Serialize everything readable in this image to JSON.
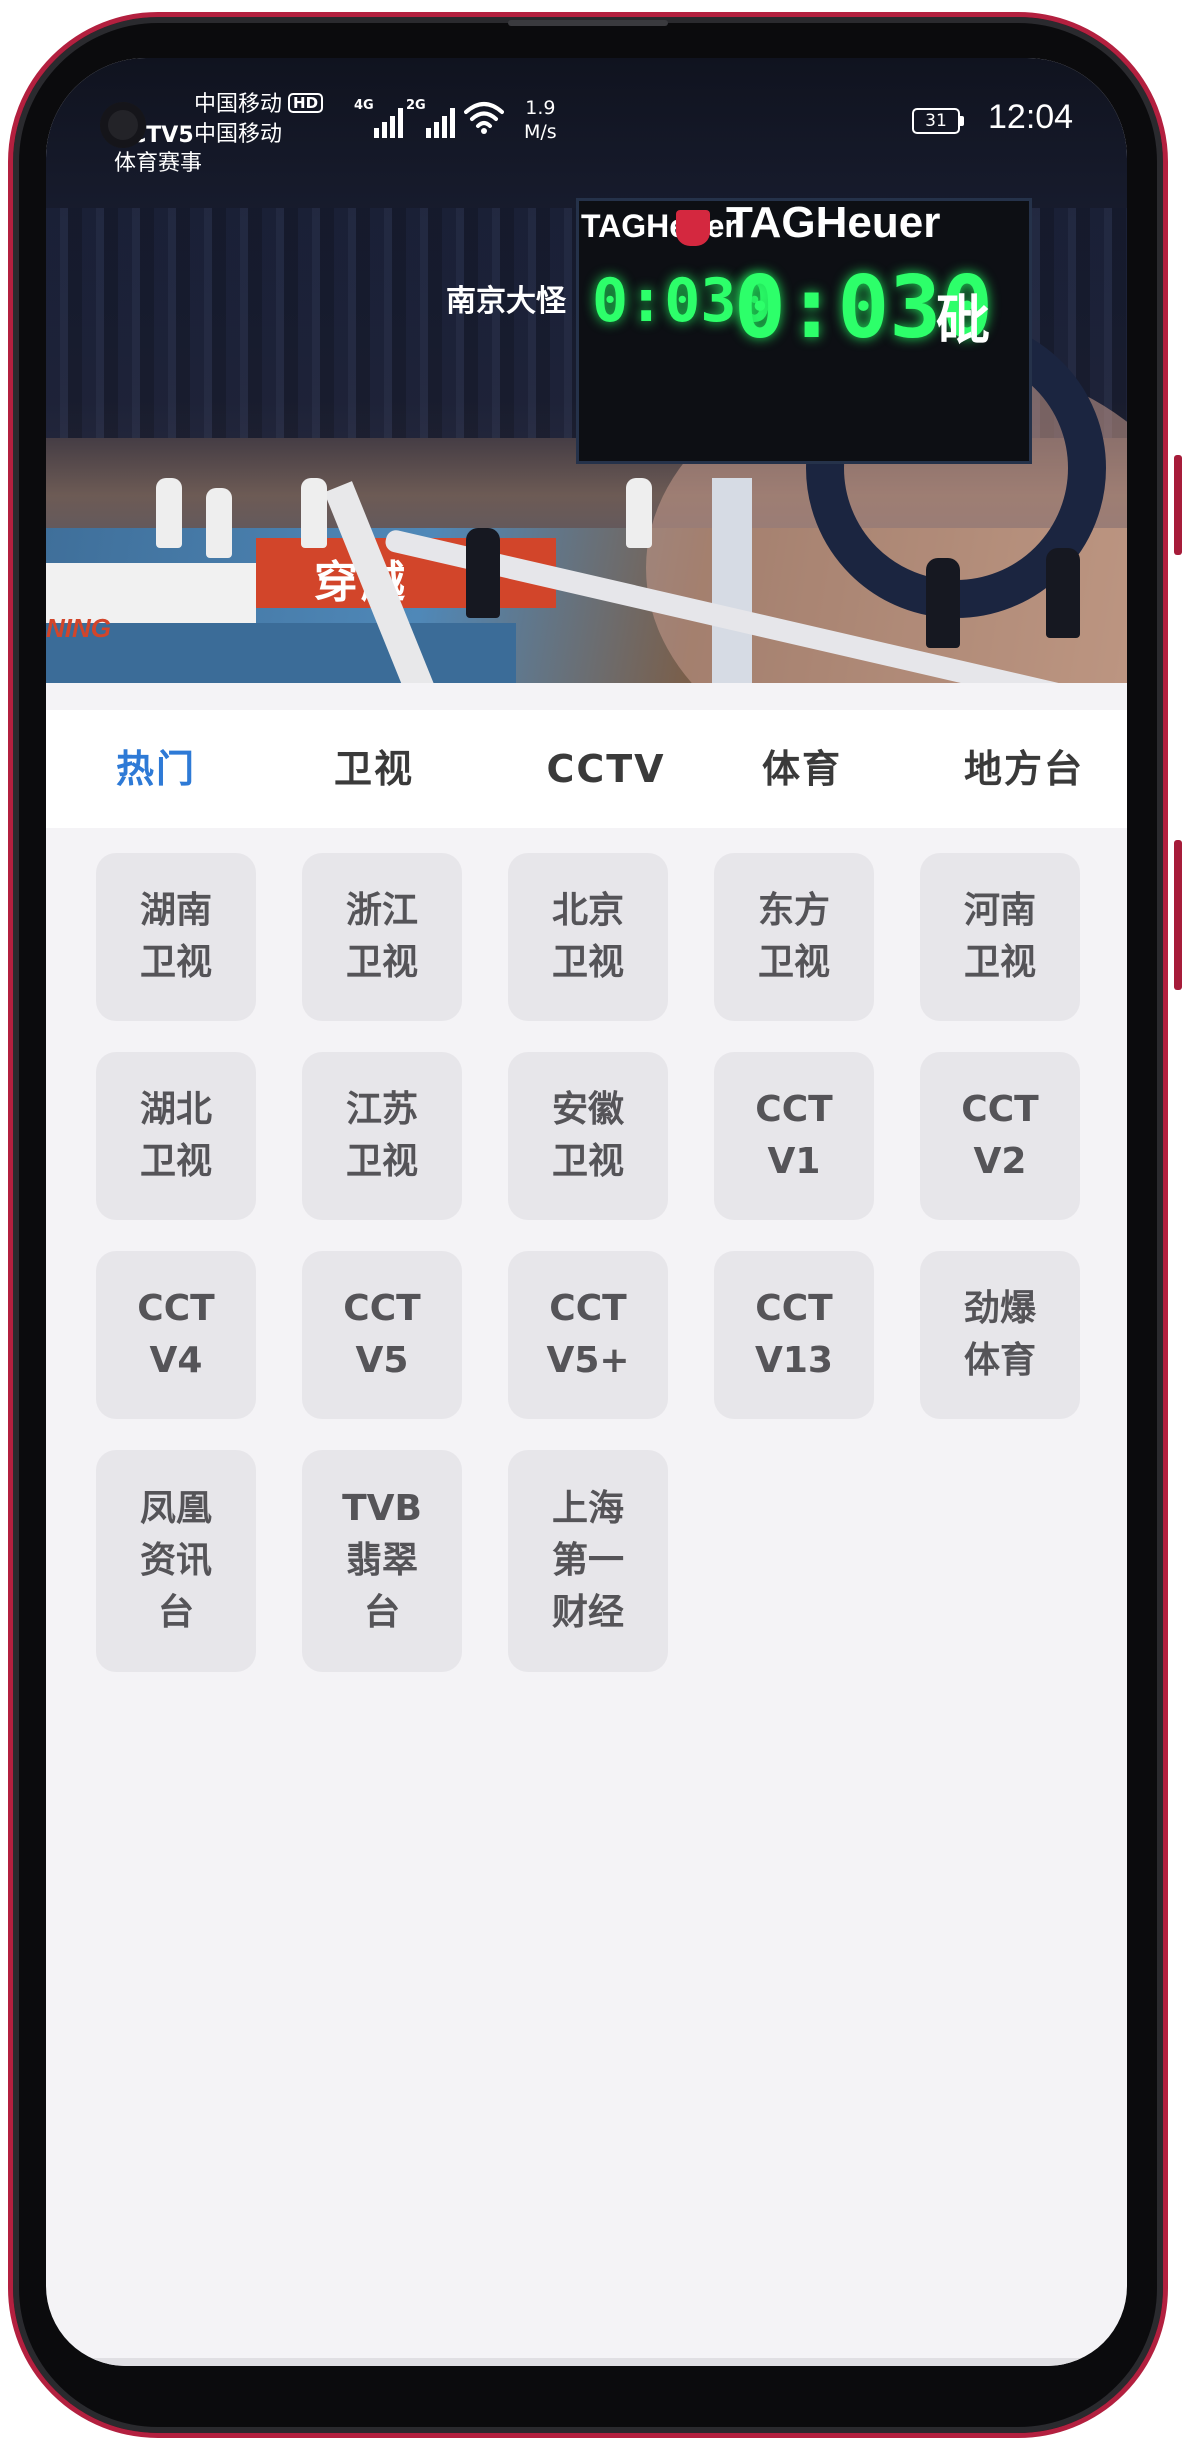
{
  "status_bar": {
    "carrier_1": "中国移动",
    "carrier_badge": "HD",
    "carrier_2": "中国移动",
    "signal_1_gen": "4G",
    "signal_2_gen": "2G",
    "speed_value": "1.9",
    "speed_unit": "M/s",
    "battery": "31",
    "time": "12:04"
  },
  "video": {
    "channel_logo": "CCTV5",
    "channel_sub": "体育赛事",
    "banner_text": "穿越",
    "left_logo": "NING",
    "scoreboard_brand_small": "TAGHeuer",
    "scoreboard_brand_large": "TAGHeuer",
    "scoreboard_small_digits": "0:030",
    "scoreboard_large_digits": "0:030",
    "scoreboard_side_text": "砒",
    "arena_sign": "南京大怪"
  },
  "tabs": [
    {
      "label": "热门",
      "active": true
    },
    {
      "label": "卫视",
      "active": false
    },
    {
      "label": "CCTV",
      "active": false
    },
    {
      "label": "体育",
      "active": false
    },
    {
      "label": "地方台",
      "active": false
    }
  ],
  "channels": [
    {
      "label": "湖南\n卫视"
    },
    {
      "label": "浙江\n卫视"
    },
    {
      "label": "北京\n卫视"
    },
    {
      "label": "东方\n卫视"
    },
    {
      "label": "河南\n卫视"
    },
    {
      "label": "湖北\n卫视"
    },
    {
      "label": "江苏\n卫视"
    },
    {
      "label": "安徽\n卫视"
    },
    {
      "label": "CCT\nV1"
    },
    {
      "label": "CCT\nV2"
    },
    {
      "label": "CCT\nV4"
    },
    {
      "label": "CCT\nV5"
    },
    {
      "label": "CCT\nV5+"
    },
    {
      "label": "CCT\nV13"
    },
    {
      "label": "劲爆\n体育"
    },
    {
      "label": "凤凰\n资讯\n台"
    },
    {
      "label": "TVB\n翡翠\n台"
    },
    {
      "label": "上海\n第一\n财经"
    }
  ],
  "colors": {
    "accent": "#2e7ad6",
    "frame": "#b3203f",
    "card_bg": "#e7e6ea",
    "screen_bg": "#f4f3f6"
  }
}
